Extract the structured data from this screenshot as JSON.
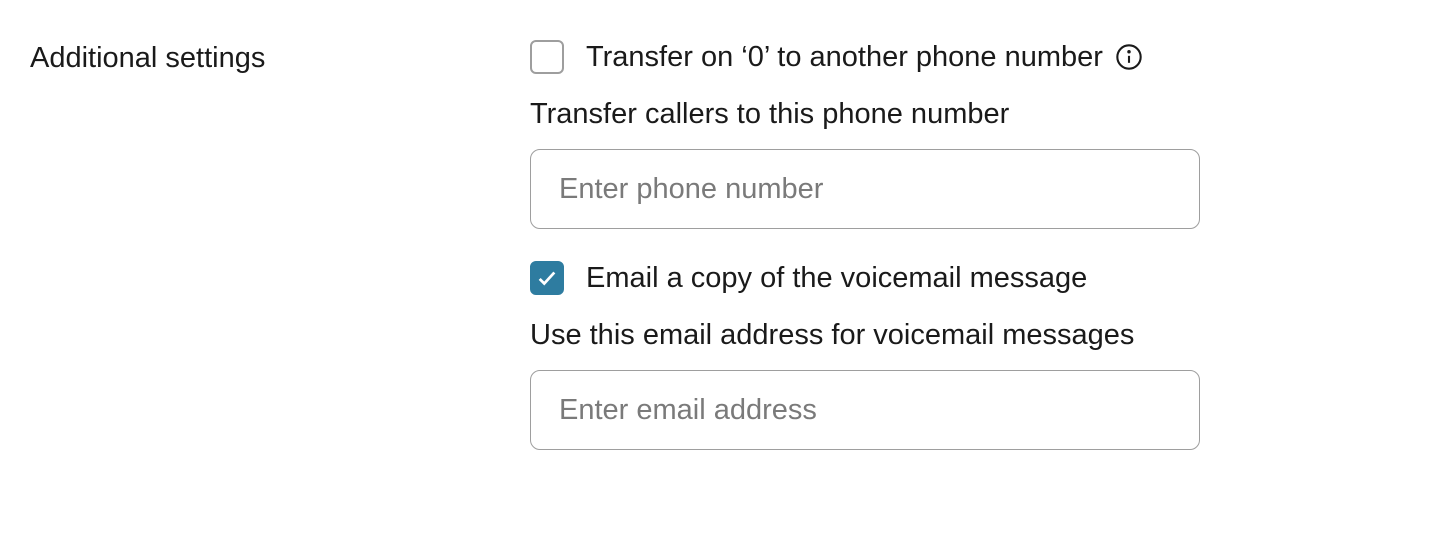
{
  "section": {
    "title": "Additional settings"
  },
  "transfer": {
    "checkbox_label": "Transfer on ‘0’ to another phone number",
    "checked": false,
    "sub_label": "Transfer callers to this phone number",
    "placeholder": "Enter phone number",
    "value": ""
  },
  "email_copy": {
    "checkbox_label": "Email a copy of the voicemail message",
    "checked": true,
    "sub_label": "Use this email address for voicemail messages",
    "placeholder": "Enter email address",
    "value": ""
  }
}
